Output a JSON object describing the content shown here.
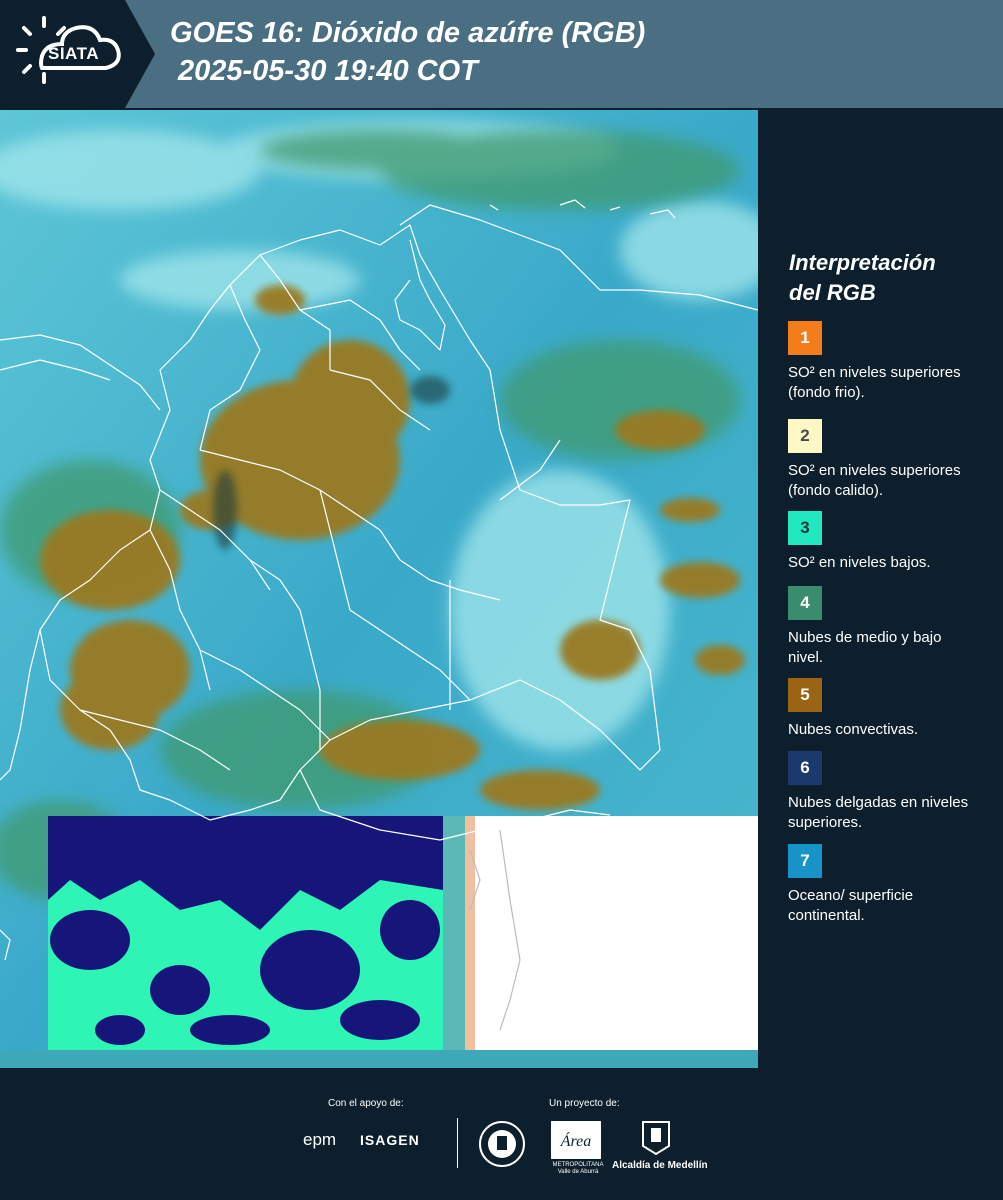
{
  "header": {
    "logo_text": "SIATA",
    "title_line1": "GOES 16: Dióxido de azúfre (RGB)",
    "title_line2": "2025-05-30 19:40 COT"
  },
  "legend": {
    "title_line1": "Interpretación",
    "title_line2": "del RGB",
    "items": [
      {
        "number": "1",
        "color": "#f47c1a",
        "text_color": "#ffffff",
        "label": "SO² en niveles superiores (fondo frio)."
      },
      {
        "number": "2",
        "color": "#fdf6c5",
        "text_color": "#4a4a4a",
        "label": "SO² en niveles superiores (fondo calido)."
      },
      {
        "number": "3",
        "color": "#22e8c0",
        "text_color": "#1a3a3a",
        "label": "SO² en niveles bajos."
      },
      {
        "number": "4",
        "color": "#3a8c6c",
        "text_color": "#ffffff",
        "label": "Nubes de medio y bajo nivel."
      },
      {
        "number": "5",
        "color": "#9a6414",
        "text_color": "#ffffff",
        "label": "Nubes convectivas."
      },
      {
        "number": "6",
        "color": "#1b3a6b",
        "text_color": "#ffffff",
        "label": "Nubes delgadas en niveles superiores."
      },
      {
        "number": "7",
        "color": "#1794c7",
        "text_color": "#ffffff",
        "label": "Oceano/ superficie continental."
      }
    ]
  },
  "footer": {
    "support_label": "Con el apoyo de:",
    "project_label": "Un proyecto de:",
    "epm": "epm",
    "isagen": "ISAGEN",
    "amva_name": "Área",
    "amva_sub": "METROPOLITANA Valle de Aburrá",
    "alcaldia": "Alcaldía de Medellín"
  }
}
